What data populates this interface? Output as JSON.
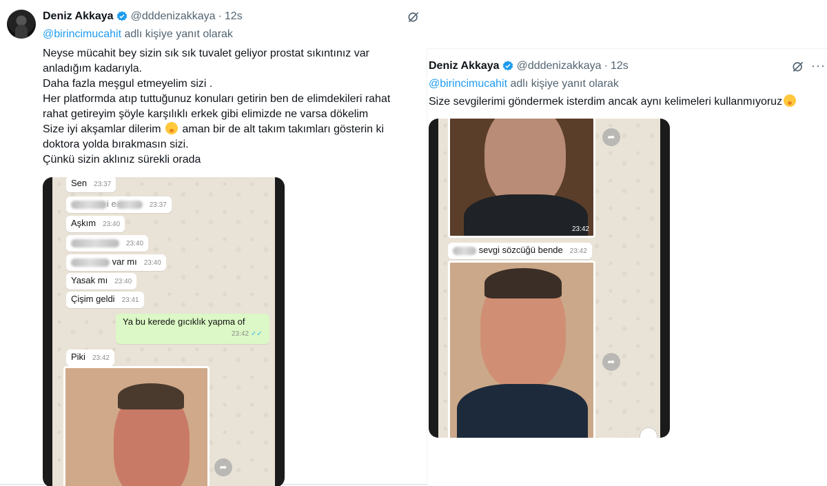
{
  "tweet_left": {
    "author_name": "Deniz Akkaya",
    "handle": "@dddenizakkaya",
    "separator": "·",
    "time": "12s",
    "replying_prefix": "@birincimucahit",
    "replying_suffix": " adlı kişiye yanıt olarak",
    "body_lines": [
      "Neyse mücahit bey sizin sık sık tuvalet geliyor prostat sıkıntınız var",
      "anladığım kadarıyla.",
      "Daha fazla meşgul etmeyelim sizi .",
      "Her platformda atıp tuttuğunuz konuları getirin ben de elimdekileri rahat",
      "rahat getireyim şöyle karşılıklı  erkek gibi elimizde ne varsa dökelim",
      "Size iyi akşamlar dilerim",
      " aman bir de alt takım takımları gösterin ki",
      "doktora yolda bırakmasın sizi.",
      "Çünkü sizin aklınız sürekli orada"
    ],
    "icons": {
      "verified": "verified-badge-icon",
      "grok": "grok-icon",
      "emoji": "smiling-face-with-hand-over-mouth-emoji"
    },
    "chat": {
      "messages": [
        {
          "text": "Sen",
          "time": "23:37"
        },
        {
          "text": "i e",
          "time": "23:37",
          "blurred": true
        },
        {
          "text": "Aşkım",
          "time": "23:40"
        },
        {
          "text": "",
          "time": "23:40",
          "blurred": true
        },
        {
          "text": "var mı",
          "time": "23:40",
          "blurred_prefix": true
        },
        {
          "text": "Yasak mı",
          "time": "23:40"
        },
        {
          "text": "Çişim geldi",
          "time": "23:41"
        },
        {
          "text": "Ya bu kerede gıcıklık yapma of",
          "time": "23:42",
          "outgoing": true,
          "ticks": "✓✓"
        },
        {
          "text": "Piki",
          "time": "23:42"
        }
      ]
    }
  },
  "tweet_right": {
    "author_name": "Deniz Akkaya",
    "handle": "@dddenizakkaya",
    "separator": "·",
    "time": "12s",
    "more": "···",
    "replying_prefix": "@birincimucahit",
    "replying_suffix": " adlı kişiye yanıt olarak",
    "body": "Size sevgilerimi göndermek isterdim ancak aynı kelimeleri kullanmıyoruz",
    "icons": {
      "verified": "verified-badge-icon",
      "grok": "grok-icon",
      "more": "more-options-icon",
      "emoji": "smiling-face-with-hand-over-mouth-emoji"
    },
    "chat": {
      "photo_time": "23:42",
      "message": {
        "text": "sevgi sözcüğü bende",
        "time": "23:42",
        "blurred_prefix": true
      }
    }
  }
}
